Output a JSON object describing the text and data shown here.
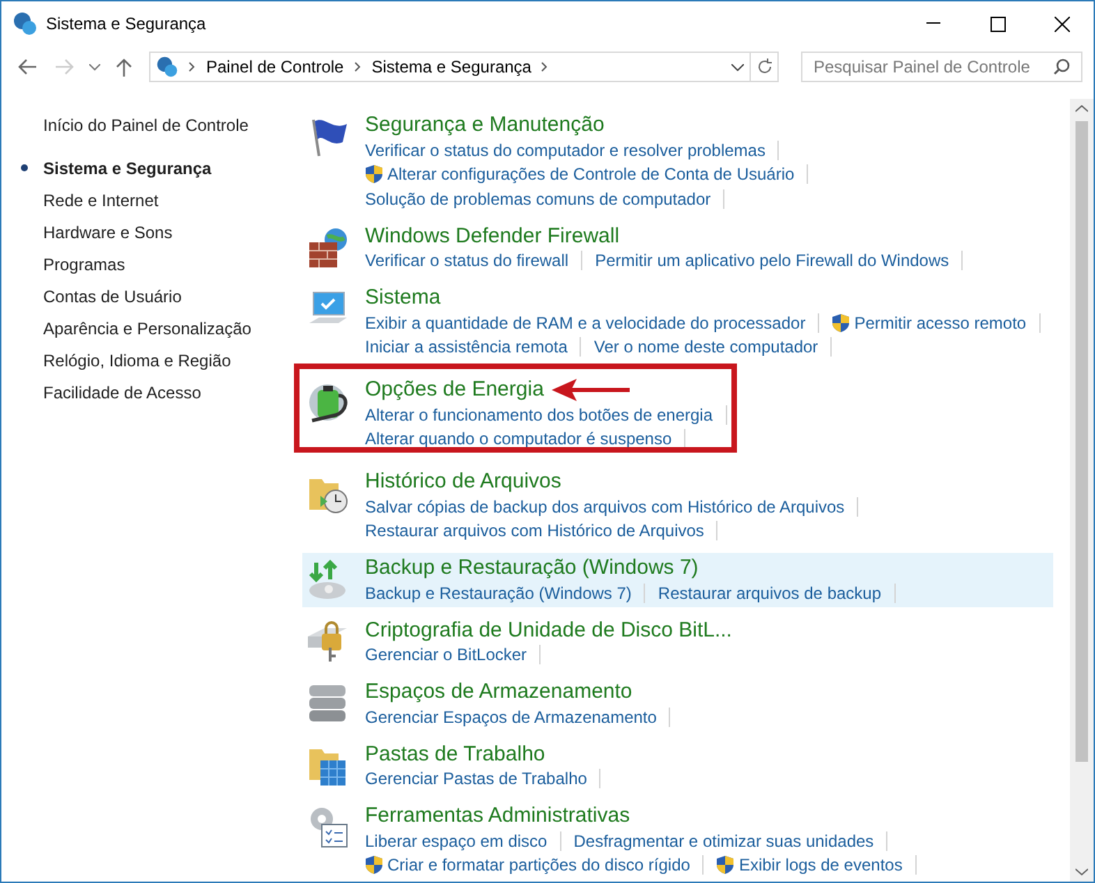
{
  "window": {
    "title": "Sistema e Segurança"
  },
  "address_bar": {
    "breadcrumbs": [
      "Painel de Controle",
      "Sistema e Segurança"
    ]
  },
  "search": {
    "placeholder": "Pesquisar Painel de Controle"
  },
  "sidebar": {
    "home": "Início do Painel de Controle",
    "items": [
      {
        "label": "Sistema e Segurança",
        "selected": true
      },
      {
        "label": "Rede e Internet",
        "selected": false
      },
      {
        "label": "Hardware e Sons",
        "selected": false
      },
      {
        "label": "Programas",
        "selected": false
      },
      {
        "label": "Contas de Usuário",
        "selected": false
      },
      {
        "label": "Aparência e Personalização",
        "selected": false
      },
      {
        "label": "Relógio, Idioma e Região",
        "selected": false
      },
      {
        "label": "Facilidade de Acesso",
        "selected": false
      }
    ]
  },
  "categories": [
    {
      "title": "Segurança e Manutenção",
      "selected": false,
      "annotated": false,
      "lines": [
        [
          {
            "text": "Verificar o status do computador e resolver problemas",
            "kind": "link"
          }
        ],
        [
          {
            "text": "Alterar configurações de Controle de Conta de Usuário",
            "kind": "admin-link"
          }
        ],
        [
          {
            "text": "Solução de problemas comuns de computador",
            "kind": "link"
          }
        ]
      ]
    },
    {
      "title": "Windows Defender Firewall",
      "selected": false,
      "annotated": false,
      "lines": [
        [
          {
            "text": "Verificar o status do firewall",
            "kind": "link"
          },
          {
            "text": "Permitir um aplicativo pelo Firewall do Windows",
            "kind": "link"
          }
        ]
      ]
    },
    {
      "title": "Sistema",
      "selected": false,
      "annotated": false,
      "lines": [
        [
          {
            "text": "Exibir a quantidade de RAM e a velocidade do processador",
            "kind": "link"
          },
          {
            "text": "Permitir acesso remoto",
            "kind": "admin-link"
          }
        ],
        [
          {
            "text": "Iniciar a assistência remota",
            "kind": "link"
          },
          {
            "text": "Ver o nome deste computador",
            "kind": "link"
          }
        ]
      ]
    },
    {
      "title": "Opções de Energia",
      "selected": false,
      "annotated": true,
      "lines": [
        [
          {
            "text": "Alterar o funcionamento dos botões de energia",
            "kind": "link"
          }
        ],
        [
          {
            "text": "Alterar quando o computador é suspenso",
            "kind": "link"
          }
        ]
      ]
    },
    {
      "title": "Histórico de Arquivos",
      "selected": false,
      "annotated": false,
      "lines": [
        [
          {
            "text": "Salvar cópias de backup dos arquivos com Histórico de Arquivos",
            "kind": "link"
          }
        ],
        [
          {
            "text": "Restaurar arquivos com Histórico de Arquivos",
            "kind": "link"
          }
        ]
      ]
    },
    {
      "title": "Backup e Restauração (Windows 7)",
      "selected": true,
      "annotated": false,
      "lines": [
        [
          {
            "text": "Backup e Restauração (Windows 7)",
            "kind": "link"
          },
          {
            "text": "Restaurar arquivos de backup",
            "kind": "link"
          }
        ]
      ]
    },
    {
      "title": "Criptografia de Unidade de Disco BitL...",
      "selected": false,
      "annotated": false,
      "lines": [
        [
          {
            "text": "Gerenciar o BitLocker",
            "kind": "link"
          }
        ]
      ]
    },
    {
      "title": "Espaços de Armazenamento",
      "selected": false,
      "annotated": false,
      "lines": [
        [
          {
            "text": "Gerenciar Espaços de Armazenamento",
            "kind": "link"
          }
        ]
      ]
    },
    {
      "title": "Pastas de Trabalho",
      "selected": false,
      "annotated": false,
      "lines": [
        [
          {
            "text": "Gerenciar Pastas de Trabalho",
            "kind": "link"
          }
        ]
      ]
    },
    {
      "title": "Ferramentas Administrativas",
      "selected": false,
      "annotated": false,
      "lines": [
        [
          {
            "text": "Liberar espaço em disco",
            "kind": "link"
          },
          {
            "text": "Desfragmentar e otimizar suas unidades",
            "kind": "link"
          }
        ],
        [
          {
            "text": "Criar e formatar partições do disco rígido",
            "kind": "admin-link"
          },
          {
            "text": "Exibir logs de eventos",
            "kind": "admin-link"
          }
        ]
      ]
    }
  ]
}
